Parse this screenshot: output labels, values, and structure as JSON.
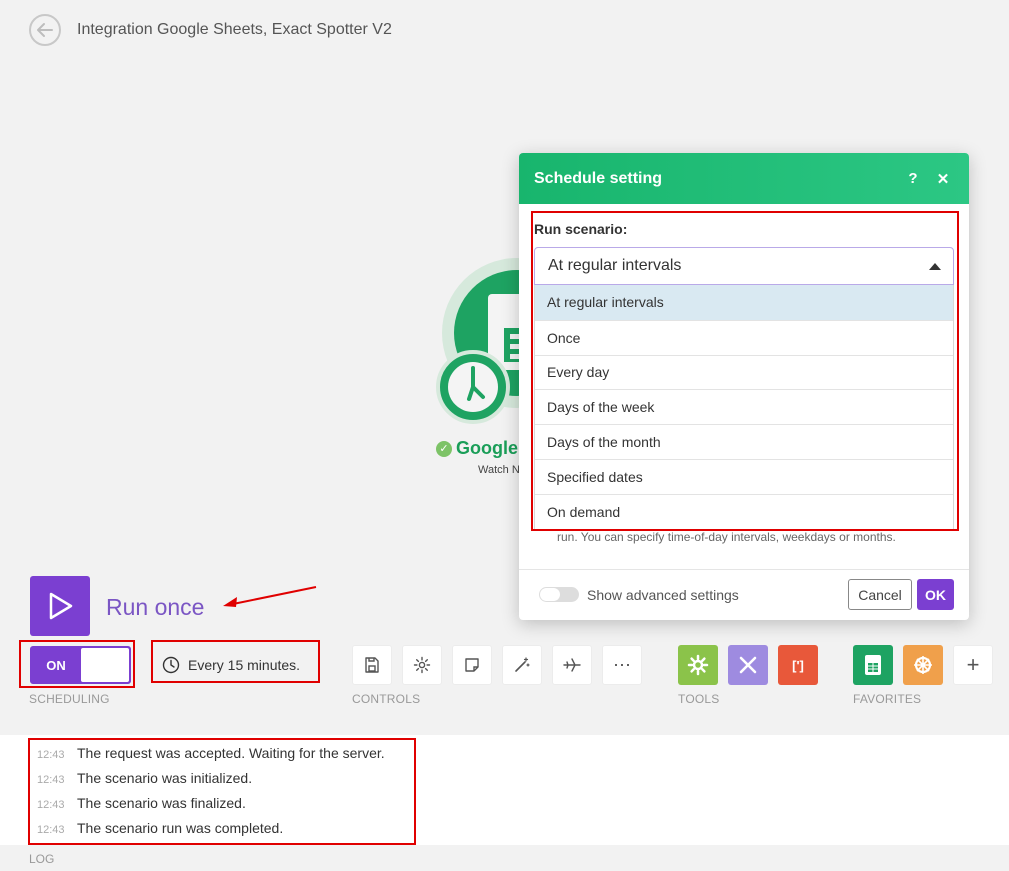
{
  "header": {
    "title": "Integration Google Sheets, Exact Spotter V2"
  },
  "module": {
    "name": "Google",
    "subtitle": "Watch N"
  },
  "modal": {
    "title": "Schedule setting",
    "help_btn": "?",
    "close_btn": "✕",
    "run_label": "Run scenario:",
    "selected": "At regular intervals",
    "options": [
      "At regular intervals",
      "Once",
      "Every day",
      "Days of the week",
      "Days of the month",
      "Specified dates",
      "On demand"
    ],
    "help_text": "run. You can specify time-of-day intervals, weekdays or months.",
    "advanced_label": "Show advanced settings",
    "cancel": "Cancel",
    "ok": "OK"
  },
  "run": {
    "label": "Run once"
  },
  "toolbar": {
    "switch_label": "ON",
    "schedule": "Every 15 minutes.",
    "more": "⋯",
    "add": "+",
    "sections": {
      "scheduling": "SCHEDULING",
      "controls": "CONTROLS",
      "tools": "TOOLS",
      "favorites": "FAVORITES"
    }
  },
  "log": {
    "label": "LOG",
    "entries": [
      {
        "time": "12:43",
        "message": "The request was accepted. Waiting for the server."
      },
      {
        "time": "12:43",
        "message": "The scenario was initialized."
      },
      {
        "time": "12:43",
        "message": "The scenario was finalized."
      },
      {
        "time": "12:43",
        "message": "The scenario run was completed."
      }
    ]
  },
  "colors": {
    "accent": "#7b3fd1",
    "header_green": "#18b56d",
    "annotation_red": "#e00000"
  }
}
